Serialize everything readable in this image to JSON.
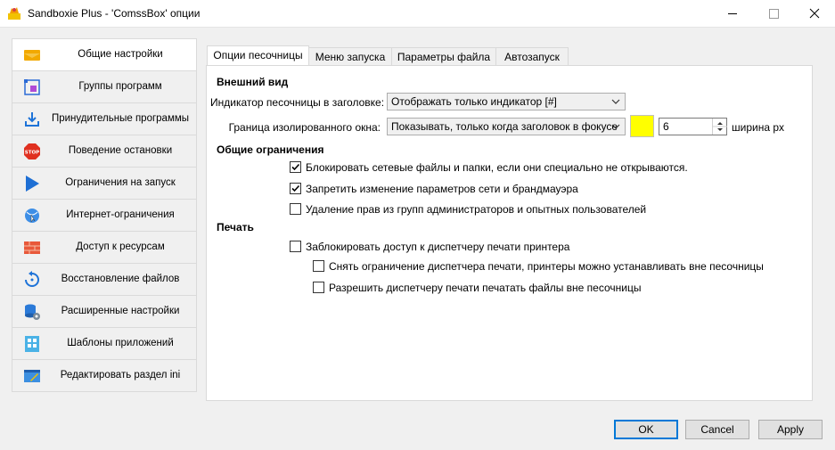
{
  "window": {
    "title": "Sandboxie Plus - 'ComssBox' опции",
    "icon": "sandboxie-app-icon"
  },
  "sidebar": {
    "items": [
      {
        "label": "Общие настройки",
        "icon": "general-settings-icon",
        "active": true
      },
      {
        "label": "Группы программ",
        "icon": "program-groups-icon"
      },
      {
        "label": "Принудительные программы",
        "icon": "forced-programs-icon"
      },
      {
        "label": "Поведение остановки",
        "icon": "stop-behavior-icon"
      },
      {
        "label": "Ограничения на запуск",
        "icon": "start-restrictions-icon"
      },
      {
        "label": "Интернет-ограничения",
        "icon": "internet-restrictions-icon"
      },
      {
        "label": "Доступ к ресурсам",
        "icon": "resource-access-icon"
      },
      {
        "label": "Восстановление файлов",
        "icon": "file-recovery-icon"
      },
      {
        "label": "Расширенные настройки",
        "icon": "advanced-settings-icon"
      },
      {
        "label": "Шаблоны приложений",
        "icon": "app-templates-icon"
      },
      {
        "label": "Редактировать раздел ini",
        "icon": "edit-ini-icon"
      }
    ]
  },
  "tabs": [
    {
      "label": "Опции песочницы",
      "active": true
    },
    {
      "label": "Меню запуска"
    },
    {
      "label": "Параметры файла"
    },
    {
      "label": "Автозапуск"
    }
  ],
  "appearance": {
    "heading": "Внешний вид",
    "indicator_label": "Индикатор песочницы в заголовке:",
    "indicator_value": "Отображать только индикатор [#]",
    "border_label": "Граница изолированного окна:",
    "border_value": "Показывать, только когда заголовок в фокусе",
    "border_color": "#ffff00",
    "border_width": "6",
    "border_width_unit": "ширина px"
  },
  "general_restrictions": {
    "heading": "Общие ограничения",
    "items": [
      {
        "label": "Блокировать сетевые файлы и папки, если они специально не открываются.",
        "checked": true
      },
      {
        "label": "Запретить изменение параметров сети и брандмауэра",
        "checked": true
      },
      {
        "label": "Удаление прав из групп администраторов и опытных пользователей",
        "checked": false
      }
    ]
  },
  "printing": {
    "heading": "Печать",
    "items": [
      {
        "label": "Заблокировать доступ к диспетчеру печати принтера",
        "checked": false
      },
      {
        "label": "Снять ограничение диспетчера печати, принтеры можно устанавливать вне песочницы",
        "checked": false
      },
      {
        "label": "Разрешить диспетчеру печати печатать файлы вне песочницы",
        "checked": false
      }
    ]
  },
  "footer": {
    "ok": "OK",
    "cancel": "Cancel",
    "apply": "Apply"
  },
  "colors": {
    "accent": "#0078d7"
  }
}
